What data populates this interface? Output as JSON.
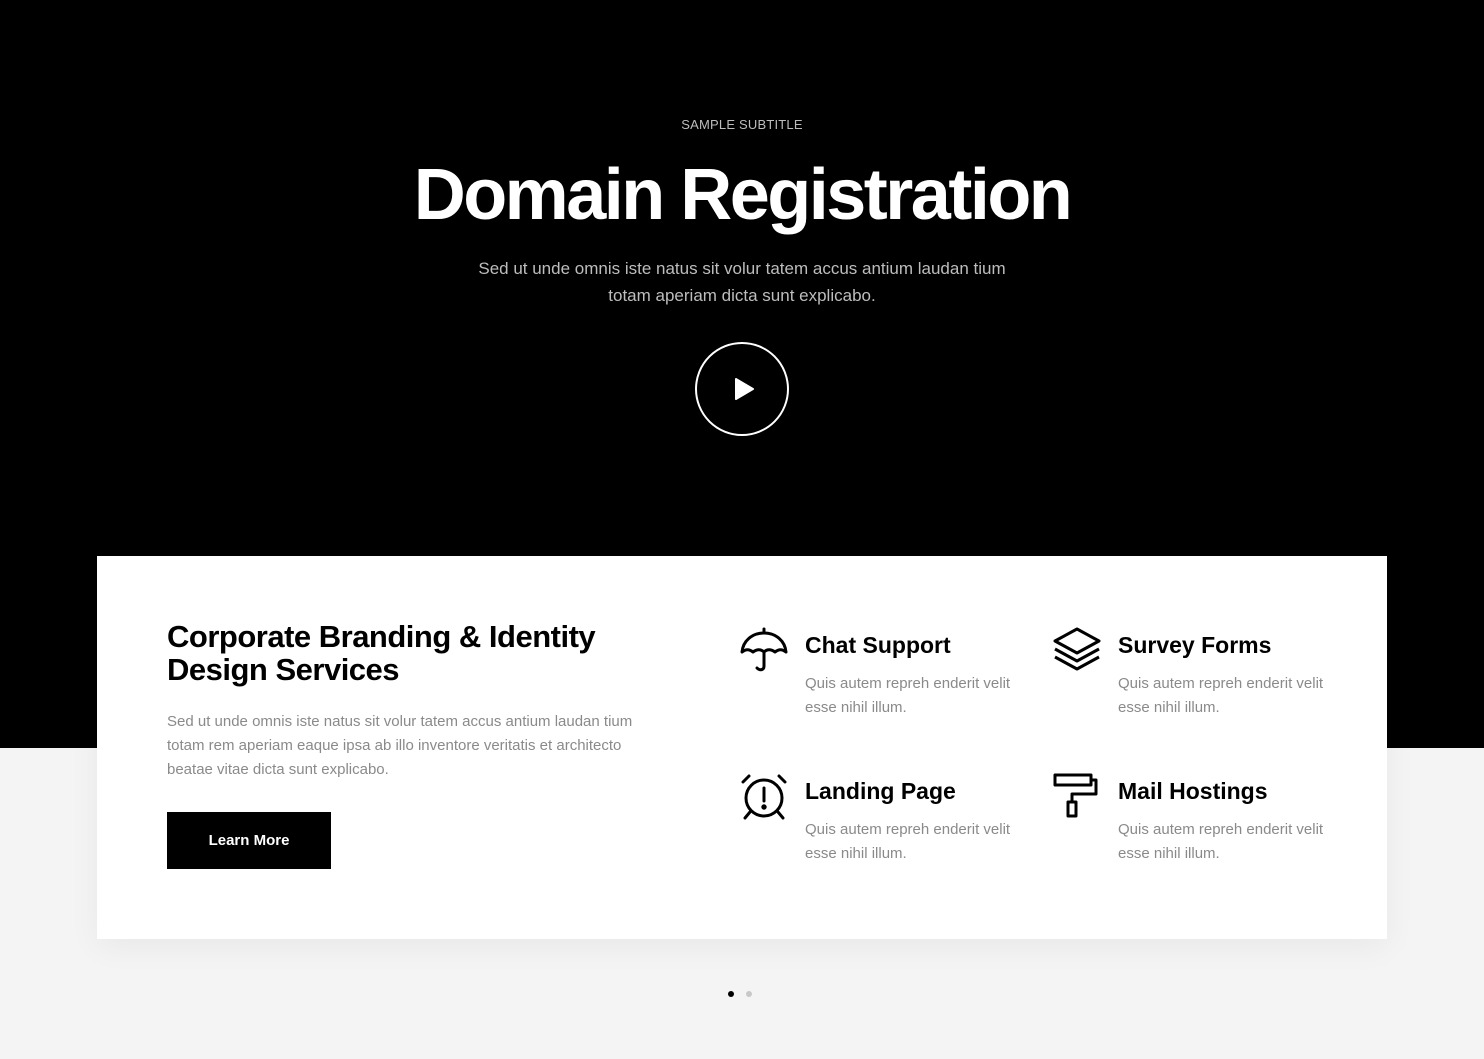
{
  "hero": {
    "subtitle": "SAMPLE SUBTITLE",
    "title": "Domain Registration",
    "lead": "Sed ut unde omnis iste natus sit volur tatem accus antium laudan tium totam aperiam dicta sunt explicabo.",
    "play_icon": "play-icon"
  },
  "card": {
    "title": "Corporate Branding & Identity Design Services",
    "text": "Sed ut unde omnis iste natus sit volur tatem accus antium laudan tium totam rem aperiam eaque ipsa ab illo inventore veritatis et architecto beatae vitae dicta sunt explicabo.",
    "button_label": "Learn More"
  },
  "features": [
    {
      "title": "Chat Support",
      "text": "Quis autem repreh enderit velit esse nihil illum.",
      "icon": "umbrella-icon"
    },
    {
      "title": "Survey Forms",
      "text": "Quis autem repreh enderit velit esse nihil illum.",
      "icon": "layers-icon"
    },
    {
      "title": "Landing Page",
      "text": "Quis autem repreh enderit velit esse nihil illum.",
      "icon": "alarm-clock-icon"
    },
    {
      "title": "Mail Hostings",
      "text": "Quis autem repreh enderit velit esse nihil illum.",
      "icon": "paint-roller-icon"
    }
  ],
  "pagination": {
    "active": 1,
    "count": 2
  },
  "colors": {
    "hero_bg": "#000000",
    "text_muted": "#8a8a8a",
    "page_bg": "#f4f4f4"
  }
}
